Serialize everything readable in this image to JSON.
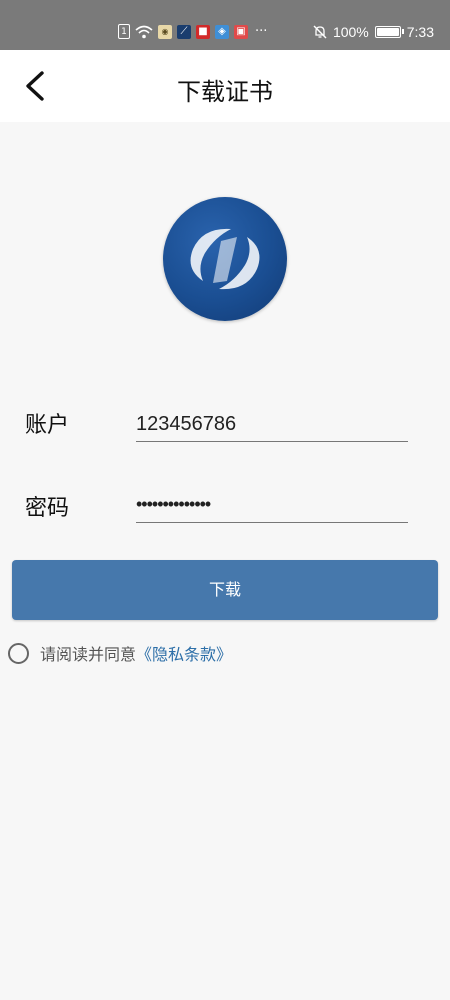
{
  "status_bar": {
    "time": "7:33",
    "battery": "100%",
    "more": "···",
    "icons": [
      "sim-icon",
      "wifi-icon",
      "app-icon",
      "app-icon",
      "app-icon",
      "app-icon",
      "app-icon",
      "mute-icon",
      "battery-icon"
    ]
  },
  "header": {
    "title": "下载证书",
    "back_icon": "chevron-left-icon"
  },
  "logo": {
    "icon": "brand-logo"
  },
  "form": {
    "account_label": "账户",
    "account_value": "123456786",
    "password_label": "密码",
    "password_value": "••••••••••••••"
  },
  "download_button": "下载",
  "agreement": {
    "text": "请阅读并同意",
    "link": "《隐私条款》"
  },
  "colors": {
    "primary": "#4678ac",
    "link": "#2d6fa8",
    "background": "#f7f7f7",
    "status_bar": "#7a7a7a",
    "logo": "#1a4e92"
  }
}
